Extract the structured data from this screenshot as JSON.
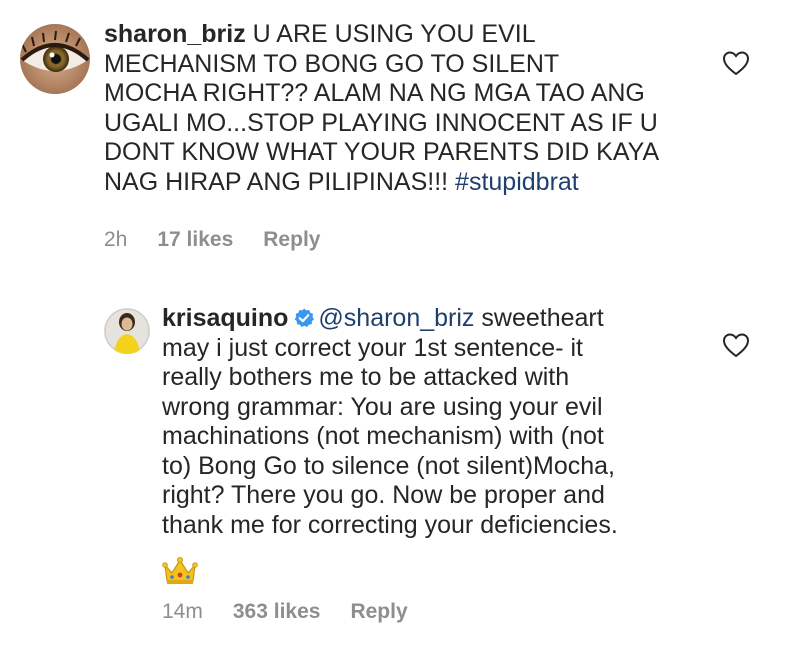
{
  "comments": [
    {
      "username": "sharon_briz",
      "text": " U ARE USING YOU EVIL\nMECHANISM TO BONG GO TO SILENT\nMOCHA RIGHT?? ALAM NA NG MGA TAO ANG\nUGALI MO...STOP PLAYING INNOCENT AS IF U\nDONT KNOW WHAT YOUR PARENTS DID KAYA\nNAG HIRAP ANG PILIPINAS!!! ",
      "hashtag": "#stupidbrat",
      "time": "2h",
      "likes": "17 likes",
      "reply": "Reply",
      "avatar_icon": "eye-avatar",
      "like_icon": "heart-outline-icon"
    },
    {
      "username": "krisaquino",
      "verified": true,
      "mention": "@sharon_briz",
      "text": " sweetheart\nmay i just correct your 1st sentence- it\nreally bothers me to be attacked with\nwrong grammar: You are using your evil\nmachinations (not mechanism) with (not\nto) Bong Go to silence (not silent)Mocha,\nright? There you go. Now be proper and\nthank me for correcting your deficiencies.",
      "emoji": "crown-icon",
      "time": "14m",
      "likes": "363 likes",
      "reply": "Reply",
      "avatar_icon": "person-yellow-avatar",
      "like_icon": "heart-outline-icon"
    }
  ],
  "colors": {
    "text": "#262626",
    "meta": "#8e8e8e",
    "link": "#1f3f6e",
    "verified": "#3897f0"
  }
}
